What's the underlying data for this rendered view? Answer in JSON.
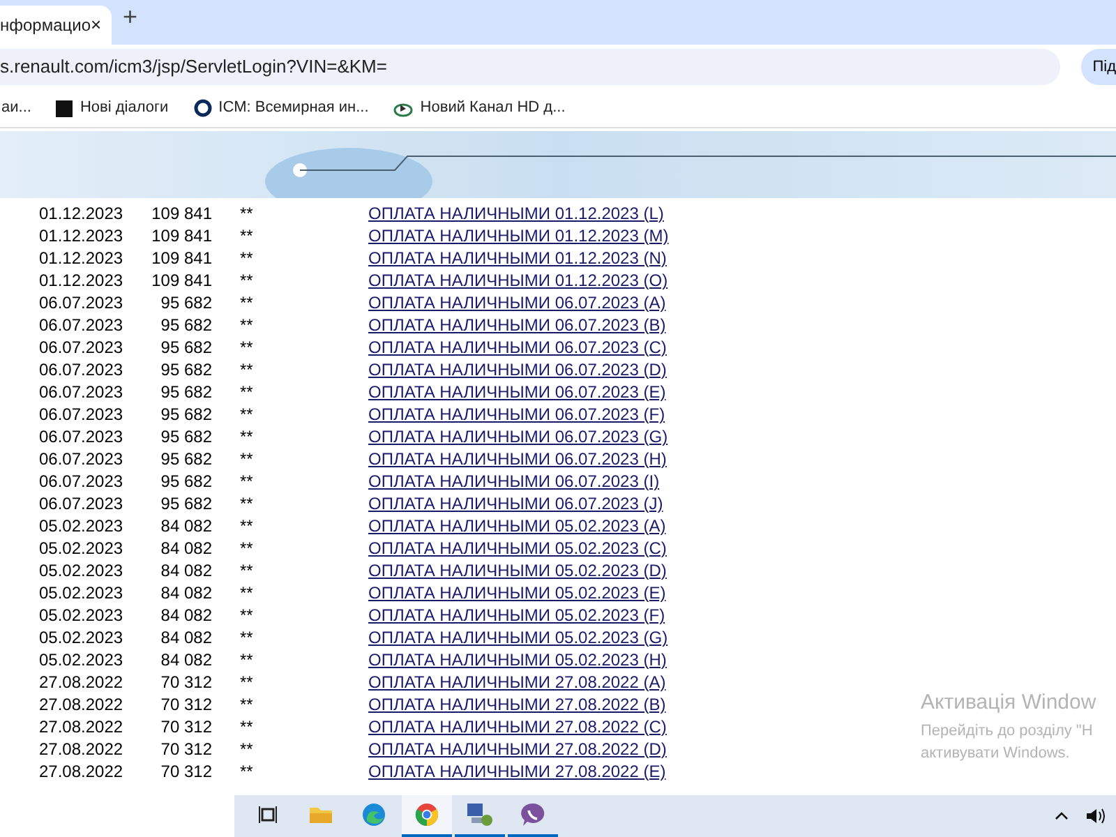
{
  "browser": {
    "tab": {
      "title": "нформацио",
      "selected": true
    },
    "tab_close": "×",
    "new_tab": "+",
    "address": "s.renault.com/icm3/jsp/ServletLogin?VIN=&KM=",
    "profile": "Під",
    "bookmarks": [
      {
        "label": "аи..."
      },
      {
        "label": "Нові діалоги"
      },
      {
        "label": "ICM: Всемирная ин..."
      },
      {
        "label": "Новий Канал HD д..."
      }
    ]
  },
  "table": {
    "rows": [
      {
        "date": "01.12.2023",
        "km": "109 841",
        "mark": "**",
        "link": "ОПЛАТА НАЛИЧНЫМИ 01.12.2023 (L)"
      },
      {
        "date": "01.12.2023",
        "km": "109 841",
        "mark": "**",
        "link": "ОПЛАТА НАЛИЧНЫМИ 01.12.2023 (M)"
      },
      {
        "date": "01.12.2023",
        "km": "109 841",
        "mark": "**",
        "link": "ОПЛАТА НАЛИЧНЫМИ 01.12.2023 (N)"
      },
      {
        "date": "01.12.2023",
        "km": "109 841",
        "mark": "**",
        "link": "ОПЛАТА НАЛИЧНЫМИ 01.12.2023 (O)"
      },
      {
        "date": "06.07.2023",
        "km": "95 682",
        "mark": "**",
        "link": "ОПЛАТА НАЛИЧНЫМИ 06.07.2023 (A)"
      },
      {
        "date": "06.07.2023",
        "km": "95 682",
        "mark": "**",
        "link": "ОПЛАТА НАЛИЧНЫМИ 06.07.2023 (B)"
      },
      {
        "date": "06.07.2023",
        "km": "95 682",
        "mark": "**",
        "link": "ОПЛАТА НАЛИЧНЫМИ 06.07.2023 (C)"
      },
      {
        "date": "06.07.2023",
        "km": "95 682",
        "mark": "**",
        "link": "ОПЛАТА НАЛИЧНЫМИ 06.07.2023 (D)"
      },
      {
        "date": "06.07.2023",
        "km": "95 682",
        "mark": "**",
        "link": "ОПЛАТА НАЛИЧНЫМИ 06.07.2023 (E)"
      },
      {
        "date": "06.07.2023",
        "km": "95 682",
        "mark": "**",
        "link": "ОПЛАТА НАЛИЧНЫМИ 06.07.2023 (F)"
      },
      {
        "date": "06.07.2023",
        "km": "95 682",
        "mark": "**",
        "link": "ОПЛАТА НАЛИЧНЫМИ 06.07.2023 (G)"
      },
      {
        "date": "06.07.2023",
        "km": "95 682",
        "mark": "**",
        "link": "ОПЛАТА НАЛИЧНЫМИ 06.07.2023 (H)"
      },
      {
        "date": "06.07.2023",
        "km": "95 682",
        "mark": "**",
        "link": "ОПЛАТА НАЛИЧНЫМИ 06.07.2023 (I)"
      },
      {
        "date": "06.07.2023",
        "km": "95 682",
        "mark": "**",
        "link": "ОПЛАТА НАЛИЧНЫМИ 06.07.2023 (J)"
      },
      {
        "date": "05.02.2023",
        "km": "84 082",
        "mark": "**",
        "link": "ОПЛАТА НАЛИЧНЫМИ 05.02.2023 (A)"
      },
      {
        "date": "05.02.2023",
        "km": "84 082",
        "mark": "**",
        "link": "ОПЛАТА НАЛИЧНЫМИ 05.02.2023 (C)"
      },
      {
        "date": "05.02.2023",
        "km": "84 082",
        "mark": "**",
        "link": "ОПЛАТА НАЛИЧНЫМИ 05.02.2023 (D)"
      },
      {
        "date": "05.02.2023",
        "km": "84 082",
        "mark": "**",
        "link": "ОПЛАТА НАЛИЧНЫМИ 05.02.2023 (E)"
      },
      {
        "date": "05.02.2023",
        "km": "84 082",
        "mark": "**",
        "link": "ОПЛАТА НАЛИЧНЫМИ 05.02.2023 (F)"
      },
      {
        "date": "05.02.2023",
        "km": "84 082",
        "mark": "**",
        "link": "ОПЛАТА НАЛИЧНЫМИ 05.02.2023 (G)"
      },
      {
        "date": "05.02.2023",
        "km": "84 082",
        "mark": "**",
        "link": "ОПЛАТА НАЛИЧНЫМИ 05.02.2023 (H)"
      },
      {
        "date": "27.08.2022",
        "km": "70 312",
        "mark": "**",
        "link": "ОПЛАТА НАЛИЧНЫМИ 27.08.2022 (A)"
      },
      {
        "date": "27.08.2022",
        "km": "70 312",
        "mark": "**",
        "link": "ОПЛАТА НАЛИЧНЫМИ 27.08.2022 (B)"
      },
      {
        "date": "27.08.2022",
        "km": "70 312",
        "mark": "**",
        "link": "ОПЛАТА НАЛИЧНЫМИ 27.08.2022 (C)"
      },
      {
        "date": "27.08.2022",
        "km": "70 312",
        "mark": "**",
        "link": "ОПЛАТА НАЛИЧНЫМИ 27.08.2022 (D)"
      },
      {
        "date": "27.08.2022",
        "km": "70 312",
        "mark": "**",
        "link": "ОПЛАТА НАЛИЧНЫМИ 27.08.2022 (E)"
      }
    ]
  },
  "activation": {
    "title": "Активація Window",
    "line_1": "Перейдіть до розділу \"Н",
    "line_2": "активувати Windows."
  },
  "taskbar": {
    "apps": [
      {
        "kind": "taskview",
        "running": false
      },
      {
        "kind": "folder",
        "running": false
      },
      {
        "kind": "edge",
        "running": false
      },
      {
        "kind": "chrome",
        "running": true
      },
      {
        "kind": "network",
        "running": true
      },
      {
        "kind": "viber",
        "running": true
      }
    ]
  }
}
